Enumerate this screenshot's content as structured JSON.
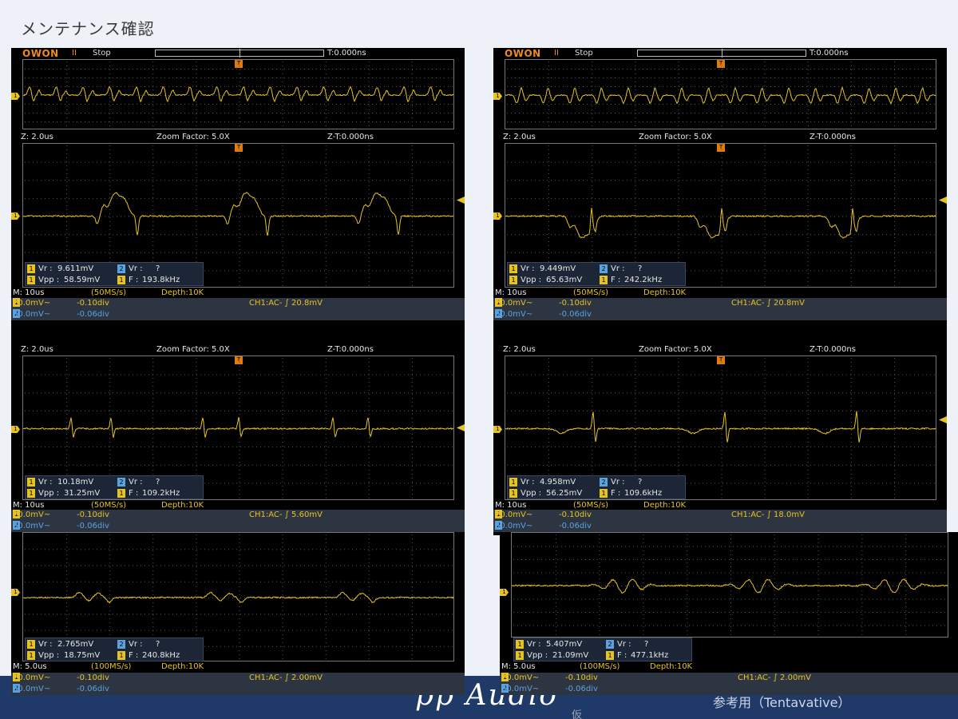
{
  "page": {
    "title": "メンテナンス確認",
    "logo": "pp Audio",
    "kari": "仮",
    "reference": "参考用（Tentavative）"
  },
  "scope_common": {
    "brand": "OWON",
    "model_mark": "II",
    "state": "Stop",
    "trigger_time": "T:0.000ns",
    "trigger_marker": "T",
    "zoom_label": "Z: 2.0us",
    "zoom_factor": "Zoom Factor: 5.0X",
    "zoom_time": "Z-T:0.000ns",
    "ch1_marker": "1",
    "ch2_marker": "2",
    "vr_label": "Vr :",
    "vpp_label": "Vpp :",
    "f_label": "F :"
  },
  "left": {
    "panel1": {
      "vr": "9.611mV",
      "ch2_vr": "?",
      "vpp": "58.59mV",
      "freq": "193.8kHz",
      "timebase": "M: 10us",
      "sample": "(50MS/s)",
      "depth": "Depth:10K",
      "ch1_scale": "20.0mV~",
      "ch1_offset": "-0.10div",
      "ch2_scale": "50.0mV~",
      "ch2_offset": "-0.06div",
      "trigger": "CH1:AC- ∫ 20.8mV"
    },
    "panel2": {
      "vr": "10.18mV",
      "ch2_vr": "?",
      "vpp": "31.25mV",
      "freq": "109.2kHz",
      "timebase": "M: 10us",
      "sample": "(50MS/s)",
      "depth": "Depth:10K",
      "ch1_scale": "20.0mV~",
      "ch1_offset": "-0.10div",
      "ch2_scale": "50.0mV~",
      "ch2_offset": "-0.06div",
      "trigger": "CH1:AC- ∫ 5.60mV"
    },
    "panel3": {
      "vr": "2.765mV",
      "ch2_vr": "?",
      "vpp": "18.75mV",
      "freq": "240.8kHz",
      "timebase": "M: 5.0us",
      "sample": "(100MS/s)",
      "depth": "Depth:10K",
      "ch1_scale": "20.0mV~",
      "ch1_offset": "-0.10div",
      "ch2_scale": "50.0mV~",
      "ch2_offset": "-0.06div",
      "trigger": "CH1:AC- ∫ 2.00mV"
    }
  },
  "right": {
    "panel1": {
      "vr": "9.449mV",
      "ch2_vr": "?",
      "vpp": "65.63mV",
      "freq": "242.2kHz",
      "timebase": "M: 10us",
      "sample": "(50MS/s)",
      "depth": "Depth:10K",
      "ch1_scale": "20.0mV~",
      "ch1_offset": "-0.10div",
      "ch2_scale": "50.0mV~",
      "ch2_offset": "-0.06div",
      "trigger": "CH1:AC- ∫ 20.8mV"
    },
    "panel2": {
      "vr": "4.958mV",
      "ch2_vr": "?",
      "vpp": "56.25mV",
      "freq": "109.6kHz",
      "timebase": "M: 10us",
      "sample": "(50MS/s)",
      "depth": "Depth:10K",
      "ch1_scale": "20.0mV~",
      "ch1_offset": "-0.10div",
      "ch2_scale": "50.0mV~",
      "ch2_offset": "-0.06div",
      "trigger": "CH1:AC- ∫ 18.0mV"
    },
    "panel3": {
      "vr": "5.407mV",
      "ch2_vr": "?",
      "vpp": "21.09mV",
      "freq": "477.1kHz",
      "timebase": "M: 5.0us",
      "sample": "(100MS/s)",
      "depth": "Depth:10K",
      "ch1_scale": "20.0mV~",
      "ch1_offset": "-0.10div",
      "ch2_scale": "50.0mV~",
      "ch2_offset": "-0.06div",
      "trigger": "CH1:AC- ∫ 2.00mV"
    }
  },
  "colors": {
    "trace": "#e6c321",
    "ch2": "#5ba3e0",
    "panel_bg": "#000000",
    "footer": "#1f3a68"
  }
}
